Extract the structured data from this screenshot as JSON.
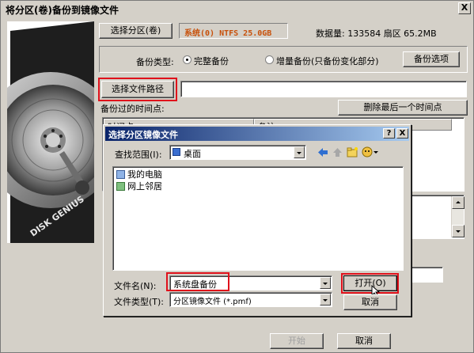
{
  "window": {
    "title": "将分区(卷)备份到镜像文件",
    "close_label": "X"
  },
  "source": {
    "select_partition_label": "选择分区(卷)",
    "selected_partition": "系统(0) NTFS 25.0GB",
    "data_size": "数据量: 133584 扇区  65.2MB"
  },
  "backup": {
    "type_label": "备份类型:",
    "full_label": "完整备份",
    "incremental_label": "增量备份(只备份变化部分)",
    "options_label": "备份选项",
    "selected": "full"
  },
  "path": {
    "select_path_label": "选择文件路径",
    "value": ""
  },
  "timepoints": {
    "label": "备份过的时间点:",
    "delete_last_label": "删除最后一个时间点",
    "col_time": "时间点",
    "col_note": "备注"
  },
  "footer": {
    "start_label": "开始",
    "cancel_label": "取消"
  },
  "dialog": {
    "title": "选择分区镜像文件",
    "help_label": "?",
    "close_label": "X",
    "look_in_label": "查找范围(I):",
    "look_in_value": "桌面",
    "items": [
      {
        "label": "我的电脑",
        "icon": "computer-icon"
      },
      {
        "label": "网上邻居",
        "icon": "network-icon"
      }
    ],
    "filename_label": "文件名(N):",
    "filename_value": "系统盘备份",
    "filetype_label": "文件类型(T):",
    "filetype_value": "分区镜像文件 (*.pmf)",
    "open_label": "打开(O)",
    "cancel_label": "取消"
  },
  "art": {
    "text": "DISK GENIUS"
  },
  "colors": {
    "highlight": "#e0111b",
    "title_start": "#0a246a",
    "title_end": "#a6caf0",
    "partition_text": "#c8500a"
  }
}
